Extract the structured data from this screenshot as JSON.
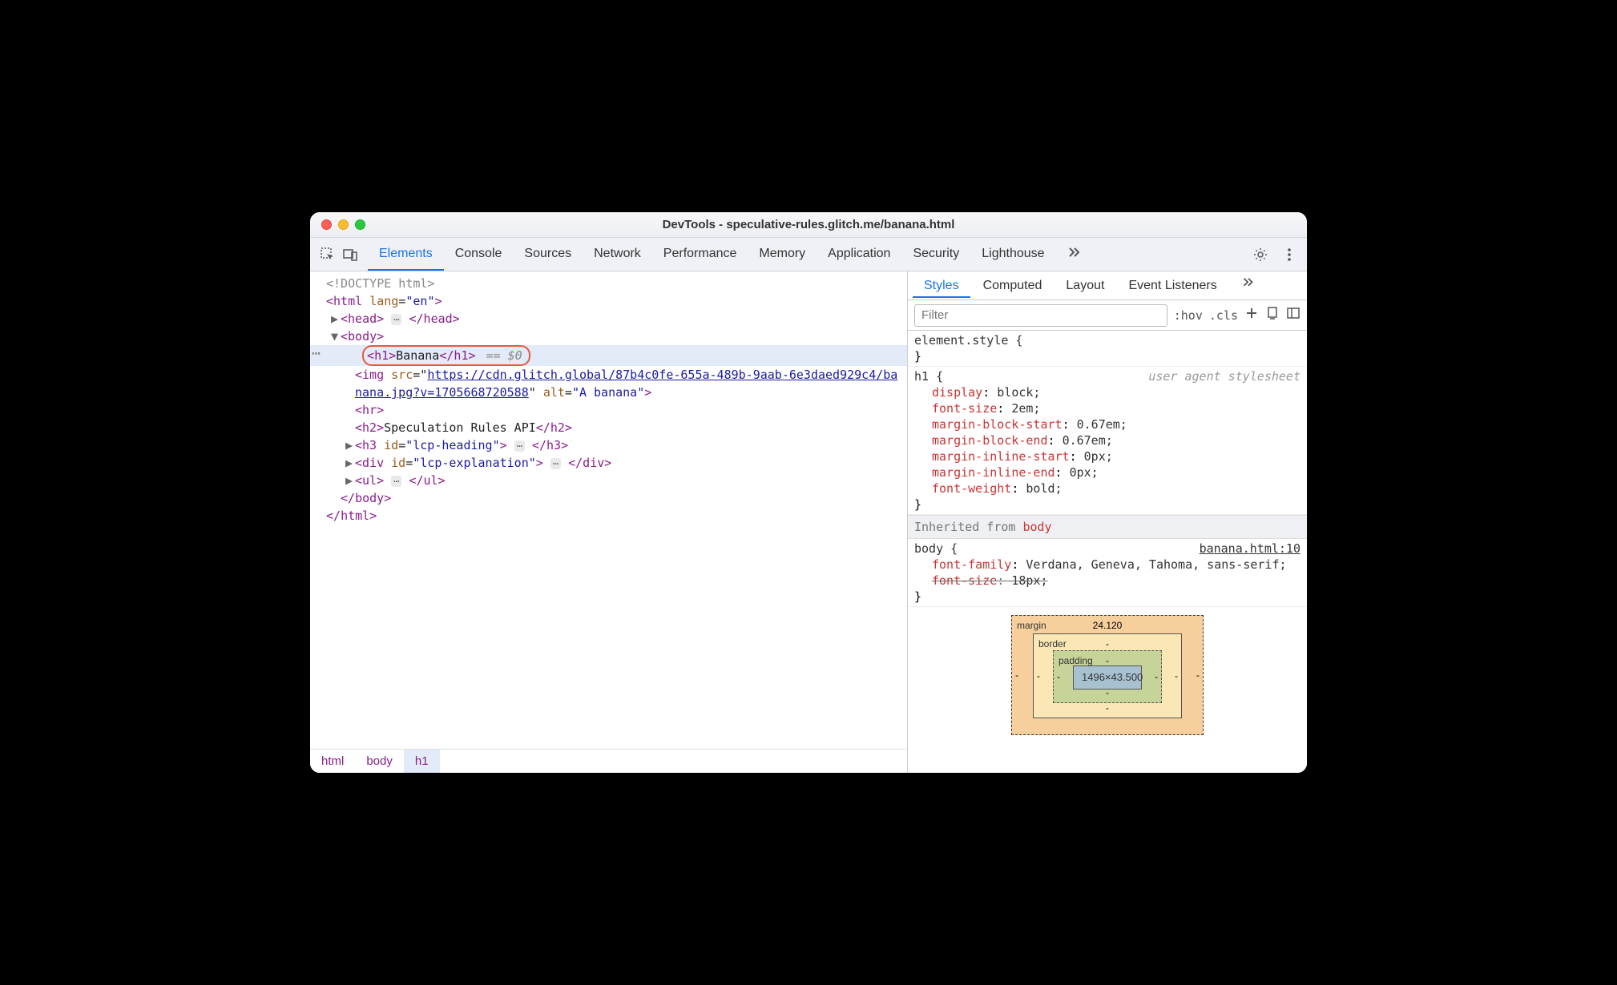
{
  "window": {
    "title": "DevTools - speculative-rules.glitch.me/banana.html"
  },
  "mainTabs": [
    "Elements",
    "Console",
    "Sources",
    "Network",
    "Performance",
    "Memory",
    "Application",
    "Security",
    "Lighthouse"
  ],
  "activeMainTab": "Elements",
  "dom": {
    "doctype": "<!DOCTYPE html>",
    "htmlOpen": {
      "tag": "html",
      "attrs": [
        {
          "n": "lang",
          "v": "en"
        }
      ]
    },
    "head": {
      "tag": "head"
    },
    "bodyOpen": {
      "tag": "body"
    },
    "selected": {
      "raw": "<h1>Banana</h1>",
      "consoleRef": "== $0"
    },
    "img": {
      "tag": "img",
      "srcPrefix": "https://cdn.glitch.global/87b4c0fe-655a-489b-9aab-6e3daed929c4/ba",
      "srcSuffix": "nana.jpg?v=1705668720588",
      "alt": "A banana"
    },
    "hr": {
      "raw": "<hr>"
    },
    "h2": {
      "tag": "h2",
      "text": "Speculation Rules API"
    },
    "h3": {
      "tag": "h3",
      "attrs": [
        {
          "n": "id",
          "v": "lcp-heading"
        }
      ]
    },
    "div": {
      "tag": "div",
      "attrs": [
        {
          "n": "id",
          "v": "lcp-explanation"
        }
      ]
    },
    "ul": {
      "tag": "ul"
    },
    "bodyClose": "</body>",
    "htmlClose": "</html>"
  },
  "breadcrumb": [
    "html",
    "body",
    "h1"
  ],
  "stylesTabs": [
    "Styles",
    "Computed",
    "Layout",
    "Event Listeners"
  ],
  "activeStylesTab": "Styles",
  "filterPlaceholder": "Filter",
  "hov": ":hov",
  "cls": ".cls",
  "rules": {
    "elementStyle": "element.style {",
    "uaTag": "user agent stylesheet",
    "h1": {
      "selector": "h1 {",
      "props": [
        {
          "n": "display",
          "v": "block;"
        },
        {
          "n": "font-size",
          "v": "2em;"
        },
        {
          "n": "margin-block-start",
          "v": "0.67em;"
        },
        {
          "n": "margin-block-end",
          "v": "0.67em;"
        },
        {
          "n": "margin-inline-start",
          "v": "0px;"
        },
        {
          "n": "margin-inline-end",
          "v": "0px;"
        },
        {
          "n": "font-weight",
          "v": "bold;"
        }
      ]
    },
    "inheritedLabel": "Inherited from ",
    "inheritedFrom": "body",
    "body": {
      "selector": "body {",
      "src": "banana.html:10",
      "props": [
        {
          "n": "font-family",
          "v": "Verdana, Geneva, Tahoma, sans-serif;",
          "strike": false
        },
        {
          "n": "font-size",
          "v": "18px;",
          "strike": true
        }
      ]
    }
  },
  "boxModel": {
    "marginLabel": "margin",
    "marginTop": "24.120",
    "borderLabel": "border",
    "borderTop": "-",
    "paddingLabel": "padding",
    "paddingTop": "-",
    "content": "1496×43.500",
    "dash": "-"
  }
}
